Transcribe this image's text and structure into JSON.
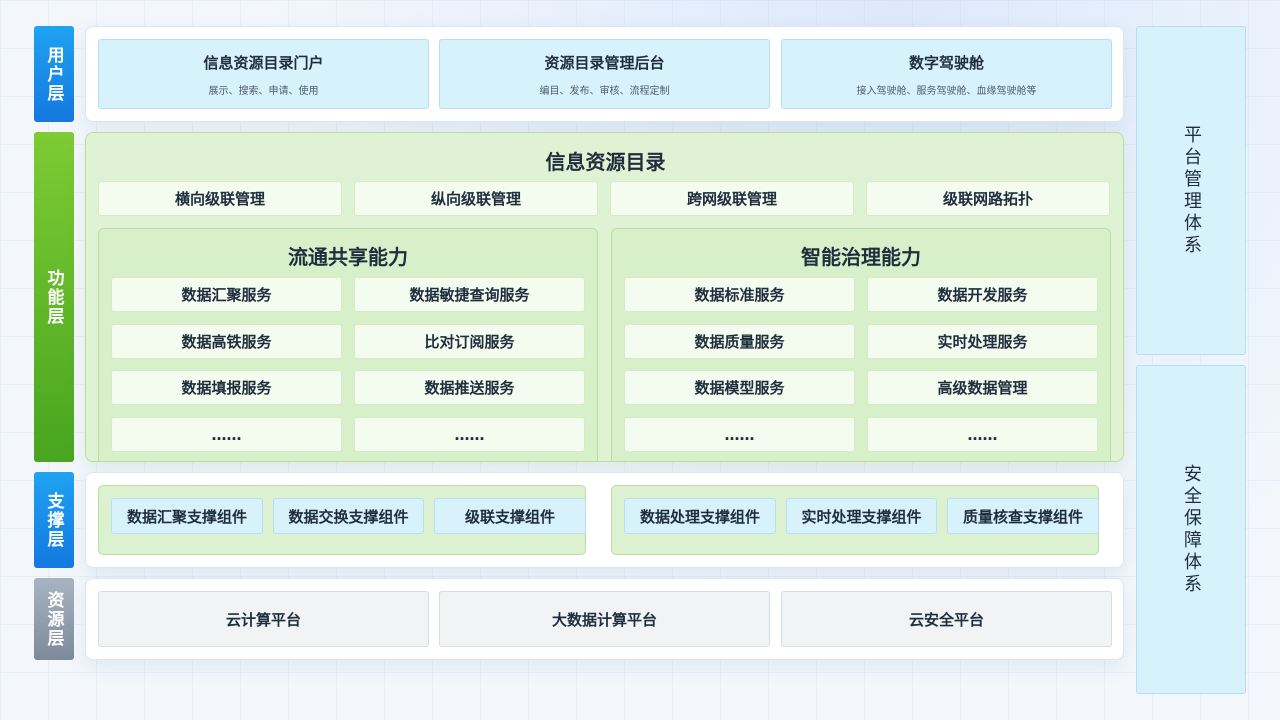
{
  "layers": {
    "user": "用户层",
    "function": "功能层",
    "support": "支撑层",
    "resource": "资源层"
  },
  "user_layer": {
    "cards": [
      {
        "title": "信息资源目录门户",
        "subtitle": "展示、搜索、申请、使用"
      },
      {
        "title": "资源目录管理后台",
        "subtitle": "编目、发布、审核、流程定制"
      },
      {
        "title": "数字驾驶舱",
        "subtitle": "接入驾驶舱、服务驾驶舱、血缘驾驶舱等"
      }
    ]
  },
  "function_layer": {
    "title": "信息资源目录",
    "cascade": [
      "横向级联管理",
      "纵向级联管理",
      "跨网级联管理",
      "级联网路拓扑"
    ],
    "sharing": {
      "title": "流通共享能力",
      "services": [
        "数据汇聚服务",
        "数据敏捷查询服务",
        "数据高铁服务",
        "比对订阅服务",
        "数据填报服务",
        "数据推送服务",
        "……",
        "……"
      ]
    },
    "governance": {
      "title": "智能治理能力",
      "services": [
        "数据标准服务",
        "数据开发服务",
        "数据质量服务",
        "实时处理服务",
        "数据模型服务",
        "高级数据管理",
        "……",
        "……"
      ]
    }
  },
  "support_layer": {
    "group1": [
      "数据汇聚支撑组件",
      "数据交换支撑组件",
      "级联支撑组件"
    ],
    "group2": [
      "数据处理支撑组件",
      "实时处理支撑组件",
      "质量核查支撑组件"
    ]
  },
  "resource_layer": {
    "platforms": [
      "云计算平台",
      "大数据计算平台",
      "云安全平台"
    ]
  },
  "side": {
    "platform": "平台管理体系",
    "security": "安全保障体系"
  },
  "colors": {
    "user_label": "#1478e0",
    "function_label": "#48a51f",
    "support_label": "#1478e0",
    "resource_label": "#7d8a9a",
    "light_blue_card": "#d8f2fc",
    "green_panel": "#dff2d4",
    "gray_card": "#f1f3f5"
  }
}
